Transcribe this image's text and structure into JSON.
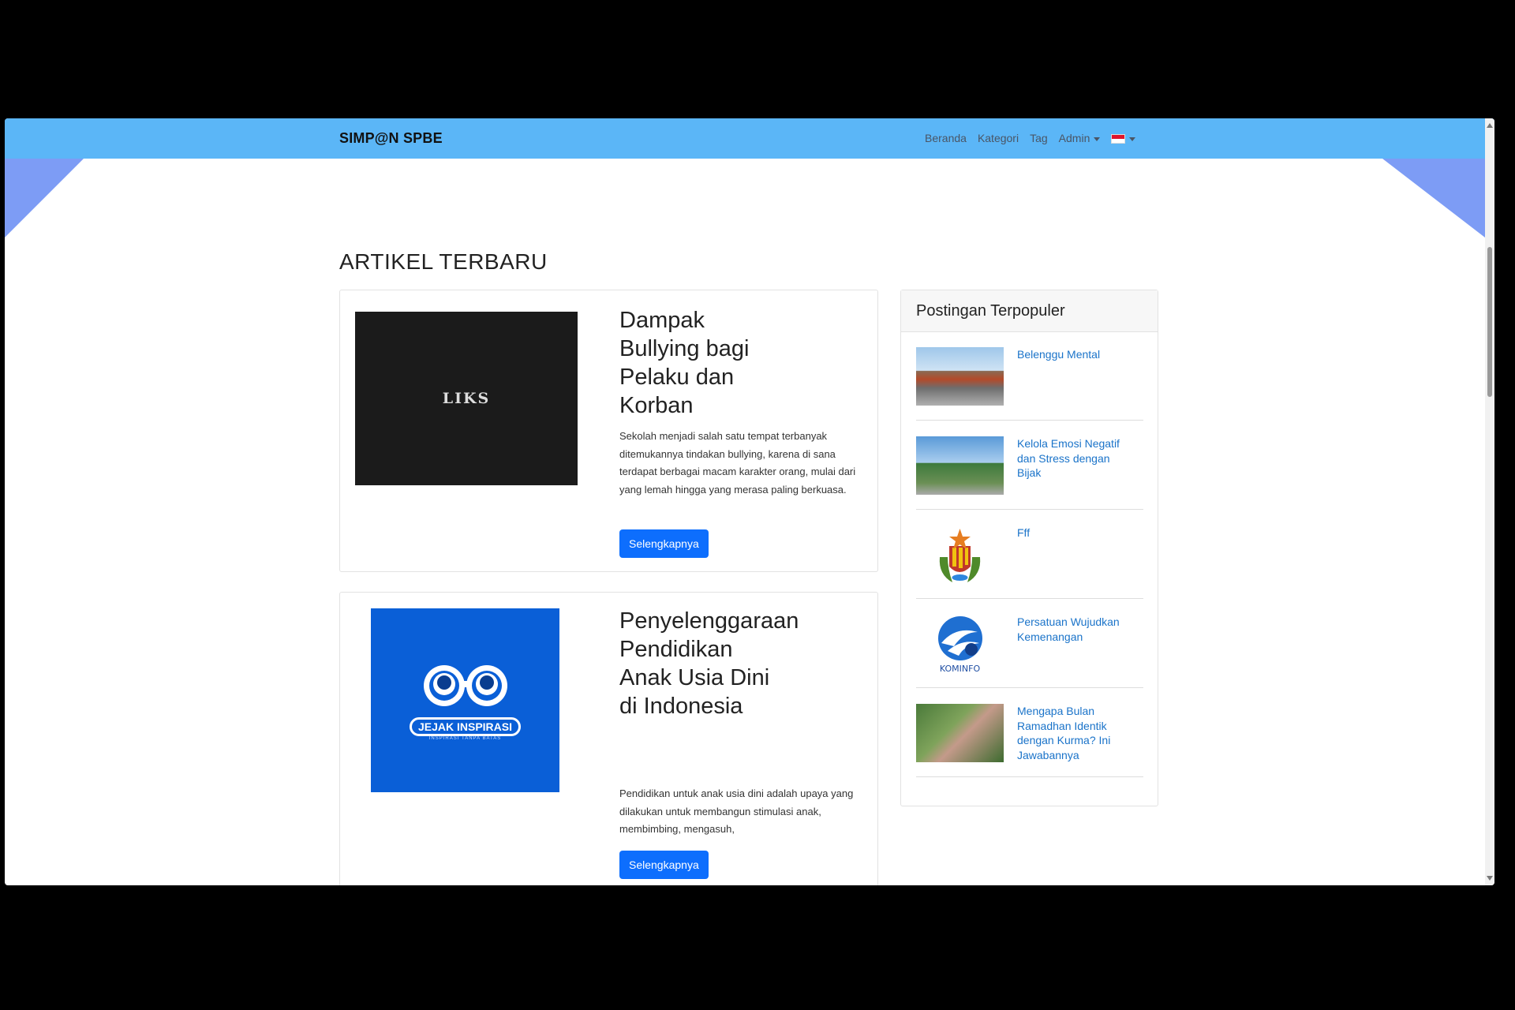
{
  "navbar": {
    "brand": "SIMP@N SPBE",
    "links": [
      "Beranda",
      "Kategori",
      "Tag"
    ],
    "admin_label": "Admin",
    "flag_colors": {
      "top": "#e0142b",
      "bottom": "#ffffff"
    }
  },
  "main": {
    "section_title": "ARTIKEL TERBARU",
    "articles": [
      {
        "image_text": "LIKS",
        "title": "Dampak Bullying bagi Pelaku dan Korban",
        "excerpt": "Sekolah menjadi salah satu tempat terbanyak ditemukannya tindakan bullying, karena di sana terdapat berbagai macam karakter orang, mulai dari yang lemah hingga yang merasa paling berkuasa.",
        "button_label": "Selengkapnya"
      },
      {
        "image_text": "JEJAK INSPIRASI",
        "image_subtext": "INSPIRASI TANPA BATAS",
        "title": "Penyelenggaraan Pendidikan Anak Usia Dini di Indonesia",
        "excerpt": "Pendidikan untuk anak usia dini adalah upaya yang dilakukan untuk membangun stimulasi anak, membimbing, mengasuh,",
        "button_label": "Selengkapnya"
      }
    ]
  },
  "sidebar": {
    "title": "Postingan Terpopuler",
    "items": [
      {
        "title": "Belenggu Mental"
      },
      {
        "title": "Kelola Emosi Negatif dan Stress dengan Bijak"
      },
      {
        "title": "Fff"
      },
      {
        "title": "Persatuan Wujudkan Kemenangan",
        "image_text": "KOMINFO"
      },
      {
        "title": "Mengapa Bulan Ramadhan Identik dengan Kurma? Ini Jawabannya"
      }
    ]
  },
  "colors": {
    "navbar": "#5bb6f7",
    "accent_triangle": "#7d9cf5",
    "button": "#0d6efd",
    "link": "#1a73c9"
  }
}
